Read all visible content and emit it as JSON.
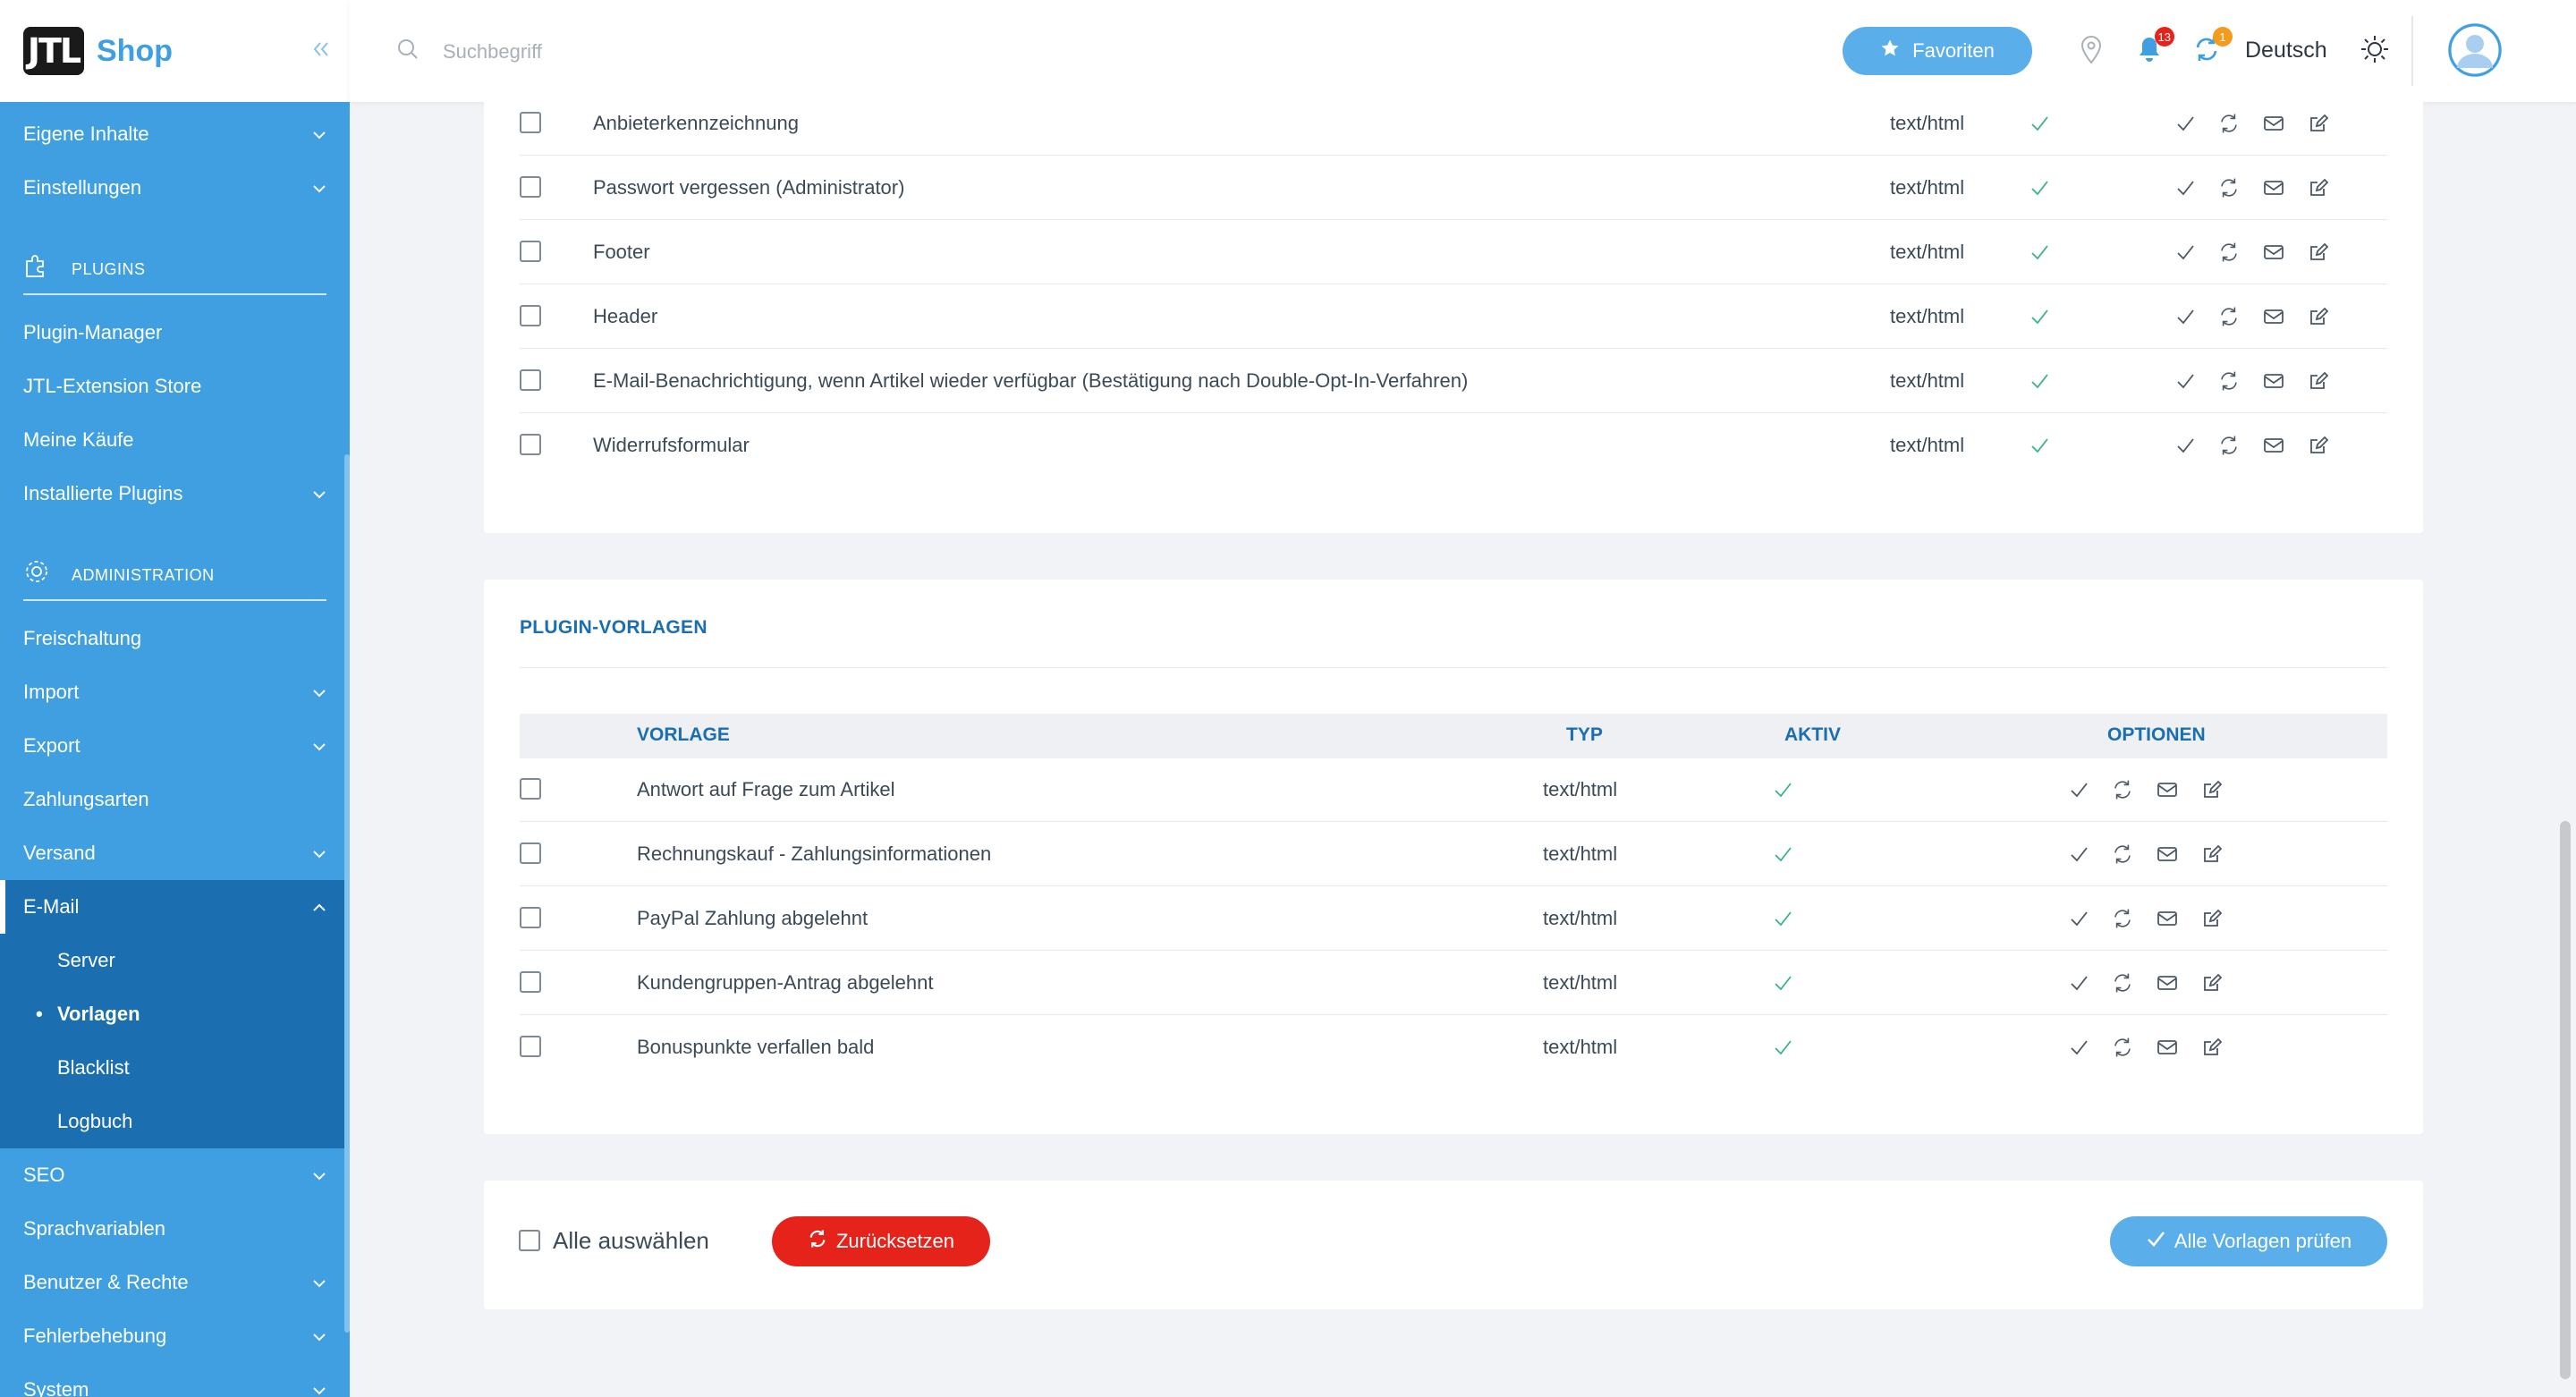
{
  "brand": {
    "logo": "JTL",
    "name": "Shop",
    "collapse_icon": "double-chevron-left-icon"
  },
  "search": {
    "placeholder": "Suchbegriff"
  },
  "topbar": {
    "favorites_label": "Favoriten",
    "notifications_count": "13",
    "updates_count": "1",
    "language": "Deutsch"
  },
  "sidebar": {
    "items_top": [
      {
        "label": "Eigene Inhalte",
        "expandable": true
      },
      {
        "label": "Einstellungen",
        "expandable": true
      }
    ],
    "section_plugins": "PLUGINS",
    "plugins_items": [
      {
        "label": "Plugin-Manager",
        "expandable": false
      },
      {
        "label": "JTL-Extension Store",
        "expandable": false
      },
      {
        "label": "Meine Käufe",
        "expandable": false
      },
      {
        "label": "Installierte Plugins",
        "expandable": true
      }
    ],
    "section_admin": "ADMINISTRATION",
    "admin_items": [
      {
        "label": "Freischaltung",
        "expandable": false
      },
      {
        "label": "Import",
        "expandable": true
      },
      {
        "label": "Export",
        "expandable": true
      },
      {
        "label": "Zahlungsarten",
        "expandable": false
      },
      {
        "label": "Versand",
        "expandable": true
      }
    ],
    "email": {
      "label": "E-Mail",
      "sub": [
        "Server",
        "Vorlagen",
        "Blacklist",
        "Logbuch"
      ],
      "active_sub": "Vorlagen"
    },
    "items_bottom": [
      {
        "label": "SEO",
        "expandable": true
      },
      {
        "label": "Sprachvariablen",
        "expandable": false
      },
      {
        "label": "Benutzer & Rechte",
        "expandable": true
      },
      {
        "label": "Fehlerbehebung",
        "expandable": true
      },
      {
        "label": "System",
        "expandable": true
      }
    ]
  },
  "upper_table": {
    "rows": [
      {
        "name": "Anbieterkennzeichnung",
        "type": "text/html"
      },
      {
        "name": "Passwort vergessen (Administrator)",
        "type": "text/html"
      },
      {
        "name": "Footer",
        "type": "text/html"
      },
      {
        "name": "Header",
        "type": "text/html"
      },
      {
        "name": "E-Mail-Benachrichtigung, wenn Artikel wieder verfügbar (Bestätigung nach Double-Opt-In-Verfahren)",
        "type": "text/html"
      },
      {
        "name": "Widerrufsformular",
        "type": "text/html"
      }
    ]
  },
  "plugin_table": {
    "title": "PLUGIN-VORLAGEN",
    "headers": {
      "vorlage": "VORLAGE",
      "typ": "TYP",
      "aktiv": "AKTIV",
      "optionen": "OPTIONEN"
    },
    "rows": [
      {
        "name": "Antwort auf Frage zum Artikel",
        "type": "text/html"
      },
      {
        "name": "Rechnungskauf - Zahlungsinformationen",
        "type": "text/html"
      },
      {
        "name": "PayPal Zahlung abgelehnt",
        "type": "text/html"
      },
      {
        "name": "Kundengruppen-Antrag abgelehnt",
        "type": "text/html"
      },
      {
        "name": "Bonuspunkte verfallen bald",
        "type": "text/html"
      }
    ]
  },
  "footer_actions": {
    "select_all": "Alle auswählen",
    "reset": "Zurücksetzen",
    "check_all": "Alle Vorlagen prüfen"
  },
  "colors": {
    "sidebar": "#3f9fe0",
    "sidebar_active": "#1b6fb0",
    "accent": "#5aaeea",
    "danger": "#e5231b",
    "check_green": "#3bb18a",
    "notif_badge": "#e5231b",
    "update_badge": "#f39b1e"
  }
}
